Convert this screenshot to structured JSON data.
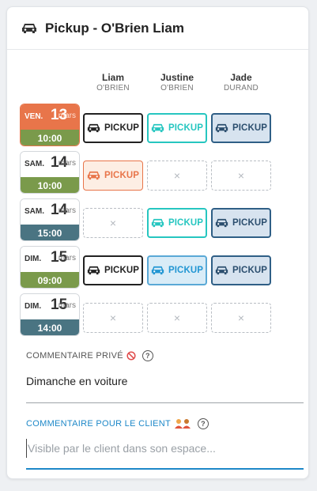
{
  "header": {
    "title": "Pickup - O'Brien Liam",
    "icon": "car-icon"
  },
  "columns": [
    {
      "first": "Liam",
      "last": "O'BRIEN"
    },
    {
      "first": "Justine",
      "last": "O'BRIEN"
    },
    {
      "first": "Jade",
      "last": "DURAND"
    }
  ],
  "pickup_label": "PICKUP",
  "empty_mark": "×",
  "slots": [
    {
      "day": "VEN.",
      "num": "13",
      "month": "mars",
      "time": "10:00",
      "time_color": "#7a9a4b",
      "active": true,
      "cells": [
        {
          "type": "pickup",
          "style": "dark"
        },
        {
          "type": "pickup",
          "style": "teal"
        },
        {
          "type": "pickup",
          "style": "navy"
        }
      ]
    },
    {
      "day": "SAM.",
      "num": "14",
      "month": "mars",
      "time": "10:00",
      "time_color": "#7a9a4b",
      "active": false,
      "cells": [
        {
          "type": "pickup",
          "style": "orange"
        },
        {
          "type": "empty"
        },
        {
          "type": "empty"
        }
      ]
    },
    {
      "day": "SAM.",
      "num": "14",
      "month": "mars",
      "time": "15:00",
      "time_color": "#4a7482",
      "active": false,
      "cells": [
        {
          "type": "empty"
        },
        {
          "type": "pickup",
          "style": "teal"
        },
        {
          "type": "pickup",
          "style": "navy"
        }
      ]
    },
    {
      "day": "DIM.",
      "num": "15",
      "month": "mars",
      "time": "09:00",
      "time_color": "#7a9a4b",
      "active": false,
      "cells": [
        {
          "type": "pickup",
          "style": "dark"
        },
        {
          "type": "pickup",
          "style": "lightblue"
        },
        {
          "type": "pickup",
          "style": "navy"
        }
      ]
    },
    {
      "day": "DIM.",
      "num": "15",
      "month": "mars",
      "time": "14:00",
      "time_color": "#4a7482",
      "active": false,
      "cells": [
        {
          "type": "empty"
        },
        {
          "type": "empty"
        },
        {
          "type": "empty"
        }
      ]
    }
  ],
  "private_comment": {
    "label": "COMMENTAIRE PRIVÉ",
    "icon": "no-entry-icon",
    "help": "?",
    "value": "Dimanche en voiture",
    "label_color": "#555555"
  },
  "client_comment": {
    "label": "COMMENTAIRE POUR LE CLIENT",
    "icon": "people-icon",
    "help": "?",
    "placeholder": "Visible par le client dans son espace...",
    "label_color": "#1e88c8"
  },
  "colors": {
    "accent_orange": "#e8754a",
    "teal": "#26c6c0",
    "navy": "#2f5f86",
    "blue": "#1e88c8"
  }
}
